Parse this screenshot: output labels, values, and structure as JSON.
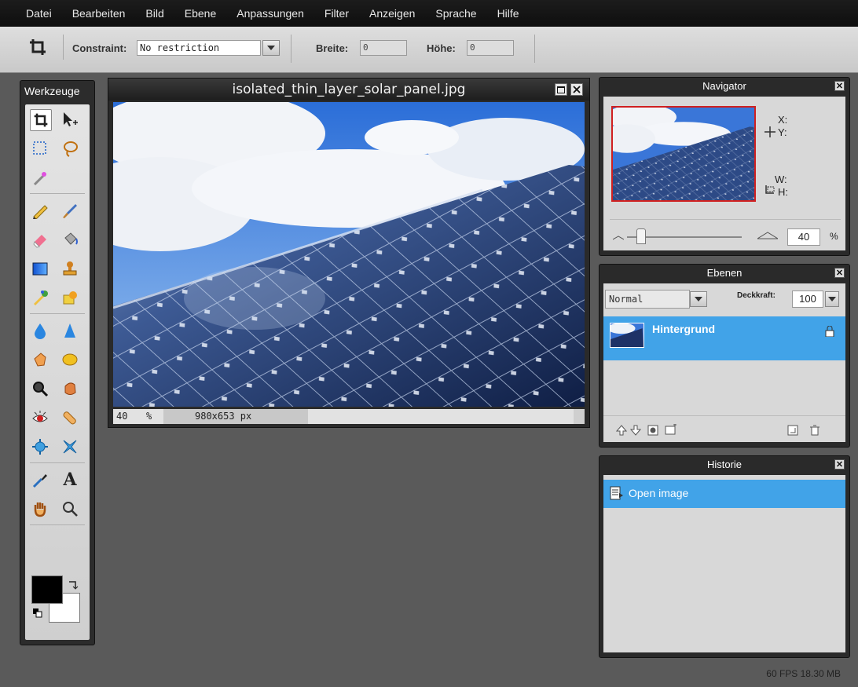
{
  "menu": [
    "Datei",
    "Bearbeiten",
    "Bild",
    "Ebene",
    "Anpassungen",
    "Filter",
    "Anzeigen",
    "Sprache",
    "Hilfe"
  ],
  "options": {
    "constraint_label": "Constraint:",
    "constraint_value": "No restriction",
    "width_label": "Breite:",
    "width_value": "0",
    "height_label": "Höhe:",
    "height_value": "0"
  },
  "toolbox": {
    "title": "Werkzeuge"
  },
  "document": {
    "title": "isolated_thin_layer_solar_panel.jpg",
    "zoom": "40",
    "zoom_unit": "%",
    "size": "980x653 px"
  },
  "navigator": {
    "title": "Navigator",
    "x_label": "X:",
    "y_label": "Y:",
    "w_label": "W:",
    "h_label": "H:",
    "zoom": "40",
    "zoom_unit": "%"
  },
  "layers": {
    "title": "Ebenen",
    "blend_mode": "Normal",
    "opacity_label": "Deckkraft:",
    "opacity_value": "100",
    "items": [
      {
        "name": "Hintergrund"
      }
    ]
  },
  "history": {
    "title": "Historie",
    "items": [
      {
        "label": "Open image"
      }
    ]
  },
  "status": {
    "fps": "60 FPS 18.30 MB"
  },
  "colors": {
    "accent": "#41a3e8",
    "foreground": "#000000",
    "background": "#ffffff"
  }
}
